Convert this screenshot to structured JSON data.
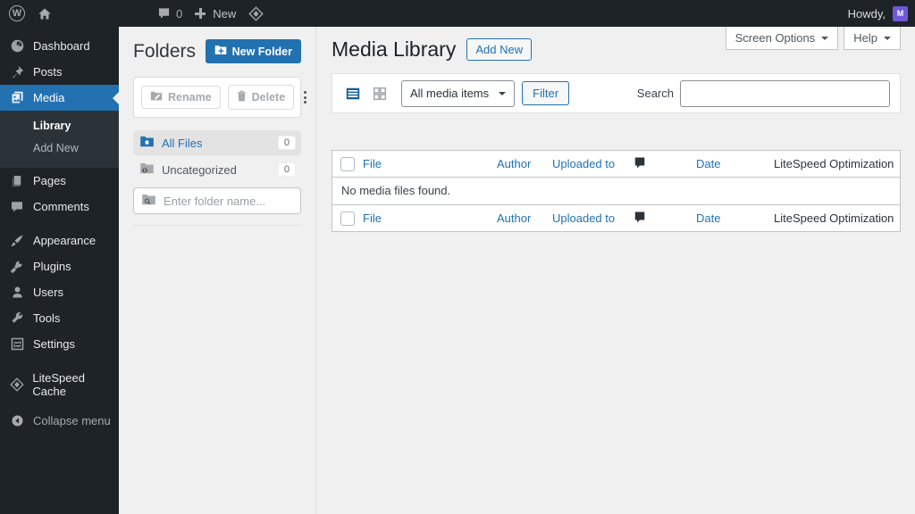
{
  "colors": {
    "accent_blue": "#2271b1",
    "dark_bar": "#1d2327",
    "submenu_bg": "#2c3338",
    "content_bg": "#f0f0f1",
    "avatar_purple": "#7058d6",
    "active_view_icon": "#135e96"
  },
  "admin_bar": {
    "wp_logo_letter": "W",
    "comments_count": "0",
    "new_label": "New",
    "howdy": "Howdy,",
    "avatar_letter": "M"
  },
  "sidebar": {
    "items": [
      {
        "label": "Dashboard"
      },
      {
        "label": "Posts"
      },
      {
        "label": "Media"
      },
      {
        "label": "Pages"
      },
      {
        "label": "Comments"
      },
      {
        "label": "Appearance"
      },
      {
        "label": "Plugins"
      },
      {
        "label": "Users"
      },
      {
        "label": "Tools"
      },
      {
        "label": "Settings"
      },
      {
        "label": "LiteSpeed Cache"
      }
    ],
    "media_submenu": [
      {
        "label": "Library"
      },
      {
        "label": "Add New"
      }
    ],
    "collapse_label": "Collapse menu"
  },
  "folders_panel": {
    "title": "Folders",
    "new_folder_label": "New Folder",
    "rename_label": "Rename",
    "delete_label": "Delete",
    "rows": [
      {
        "label": "All Files",
        "count": "0"
      },
      {
        "label": "Uncategorized",
        "count": "0"
      }
    ],
    "input_placeholder": "Enter folder name..."
  },
  "content": {
    "screen_options_label": "Screen Options",
    "help_label": "Help",
    "page_title": "Media Library",
    "add_new_label": "Add New",
    "filter": {
      "media_type_value": "All media items",
      "filter_label": "Filter",
      "search_label": "Search",
      "search_value": ""
    },
    "table": {
      "col_file": "File",
      "col_author": "Author",
      "col_uploaded": "Uploaded to",
      "col_date": "Date",
      "col_litespeed": "LiteSpeed Optimization",
      "empty_text": "No media files found."
    }
  }
}
